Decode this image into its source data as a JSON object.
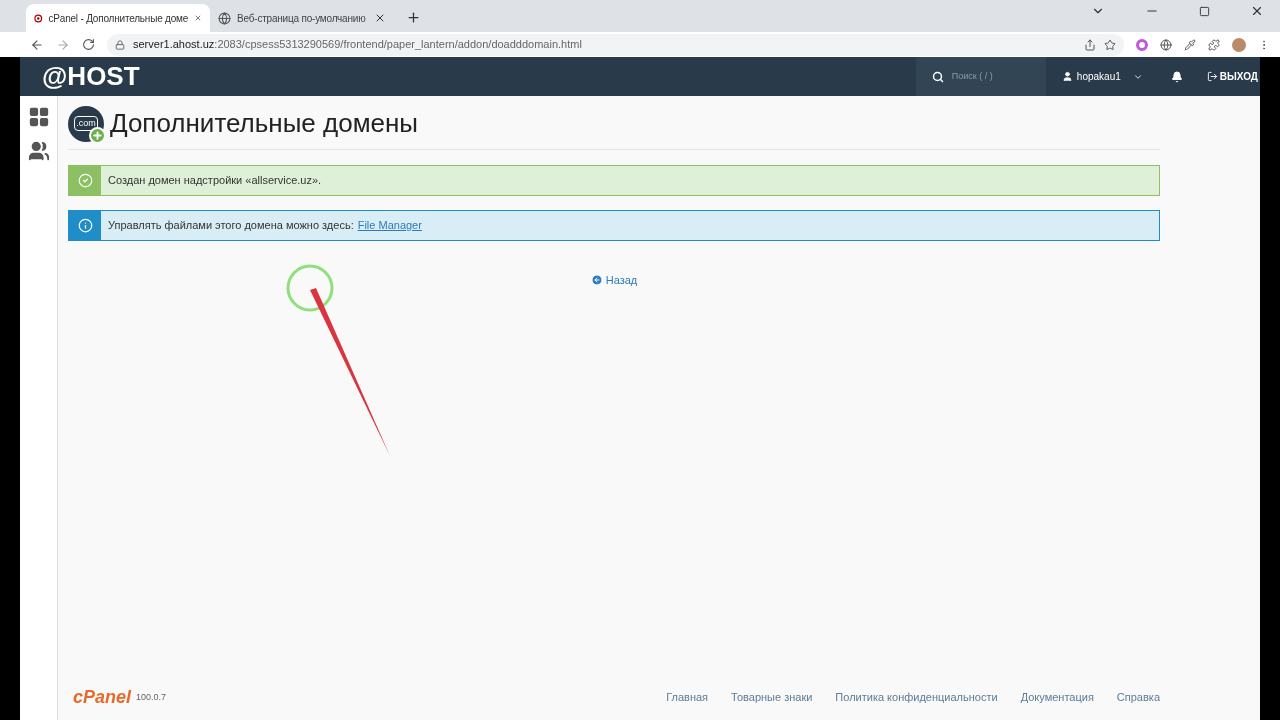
{
  "browser": {
    "tabs": [
      {
        "title": "cPanel - Дополнительные доме",
        "selected": true
      },
      {
        "title": "Веб-страница по-умолчанию",
        "selected": false
      }
    ],
    "url_host": "server1.ahost.uz",
    "url_path": ":2083/cpsess5313290569/frontend/paper_lantern/addon/doadddomain.html"
  },
  "header": {
    "logo": "@HOST",
    "search": {
      "placeholder": "Поиск ( / )"
    },
    "user": "hopakau1",
    "logout": "ВЫХОД"
  },
  "page": {
    "title": "Дополнительные домены",
    "icon_text": ".com"
  },
  "alerts": [
    {
      "kind": "success",
      "text": "Создан домен надстройки «allservice.uz»."
    },
    {
      "kind": "info",
      "text": "Управлять файлами этого домена можно здесь:",
      "link": "File Manager"
    }
  ],
  "back_link": "Назад",
  "footer": {
    "brand": "cPanel",
    "version": "100.0.7",
    "links": [
      "Главная",
      "Товарные знаки",
      "Политика конфиденциальности",
      "Документация",
      "Справка"
    ]
  }
}
